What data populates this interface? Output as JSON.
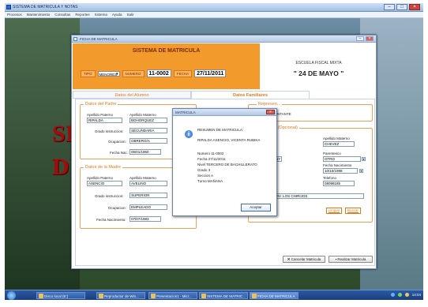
{
  "window": {
    "title": "SISTEMA DE MATRICULA Y NOTAS"
  },
  "menu": [
    "Procesos",
    "Mantenimiento",
    "Consultas",
    "Reportes",
    "Sistema",
    "Ayuda",
    "Salir"
  ],
  "background": {
    "big_text_1": "SIS",
    "big_text_2": "DI"
  },
  "ficha": {
    "title": "FICHA DE MATRICULA",
    "header_title": "SISTEMA DE MATRICULA",
    "tipo_label": "TIPO",
    "tipo_value": "MENORES",
    "numero_label": "NUMERO",
    "numero_value": "11-0002",
    "fecha_label": "FECHA",
    "fecha_value": "27/11/2011",
    "school_type": "ESCUELA FISCAL MIXTA",
    "school_name": "\" 24 DE MAYO \"",
    "tabs": [
      {
        "label": "Datos del Alumno"
      },
      {
        "label": "Datos Familiares"
      }
    ],
    "padre": {
      "legend": "Datos del Padre",
      "apellido_paterno_label": "Apellido Paterno",
      "apellido_paterno": "RIPALDA",
      "apellido_materno_label": "Apellido Materno",
      "apellido_materno": "BOHORQUEZ",
      "grado_label": "Grado instruccion:",
      "grado": "SECUNDARIA",
      "ocupacion_label": "Ocupacion:",
      "ocupacion": "OBRERO/A",
      "fecha_label": "Fecha Nac.:",
      "fecha": "05/01/1960"
    },
    "madre": {
      "legend": "Datos de la Madre",
      "apellido_paterno_label": "Apellido Paterno",
      "apellido_paterno": "ASENCIO",
      "apellido_materno_label": "Apellido Materno",
      "apellido_materno": "AVELINO",
      "grado_label": "Grado instruccion:",
      "grado": "SUPERIOR",
      "ocupacion_label": "Ocupacion:",
      "ocupacion": "EMPLEADO",
      "fecha_label": "Fecha Nacimiento:",
      "fecha": "07/07/1983"
    },
    "representante": {
      "legend": "Represen...",
      "label": "...RESENTANTE",
      "opcional_legend": "...(Opcional)",
      "apellido_paterno_label": "...terno",
      "apellido_paterno": "...ANNY",
      "apellido_materno_label": "Apellido Materno",
      "apellido_materno": "CHEVEZ",
      "ocupacion_label": "...cion",
      "parentesco_label": "Parentesco",
      "parentesco": "OTRO",
      "fecha_label": "Fecha Nacimiento",
      "fecha": "10/10/1988",
      "telefono_label": "Telefono",
      "telefono": "08098185",
      "direccion": "...3 Y AV. LOS CHIRIJOS",
      "limpiar": "Limpiar",
      "buscar": "Buscar"
    },
    "cancelar": "Cancelar Matricula",
    "realizar": "Realizar Matricula"
  },
  "modal": {
    "title": "MATRICULA",
    "lines": [
      "RESUMEN DE MATRICULA:",
      "RIPALDA ASENCIO, VICENTA RUBIKA",
      "Numero 11-0002",
      "Fecha    27/11/2011",
      "Nivel    TERCERO DE BACHILLERATO",
      "Grado   3",
      "Seccion  A",
      "Turno   MAÑANA"
    ],
    "ok": "Aceptar"
  },
  "taskbar": {
    "items": [
      {
        "label": "Disco local (E:)"
      },
      {
        "label": "Reproductor de Win..."
      },
      {
        "label": "Presentacion1 - Micr..."
      },
      {
        "label": "SISTEMA DE MATRIC..."
      },
      {
        "label": "FICHA DE MATRICULA"
      }
    ],
    "clock": "14:04"
  },
  "colors": {
    "accent": "#f39a2c",
    "tab_text": "#e27a1c",
    "taskbar": "#2a5aa6"
  }
}
